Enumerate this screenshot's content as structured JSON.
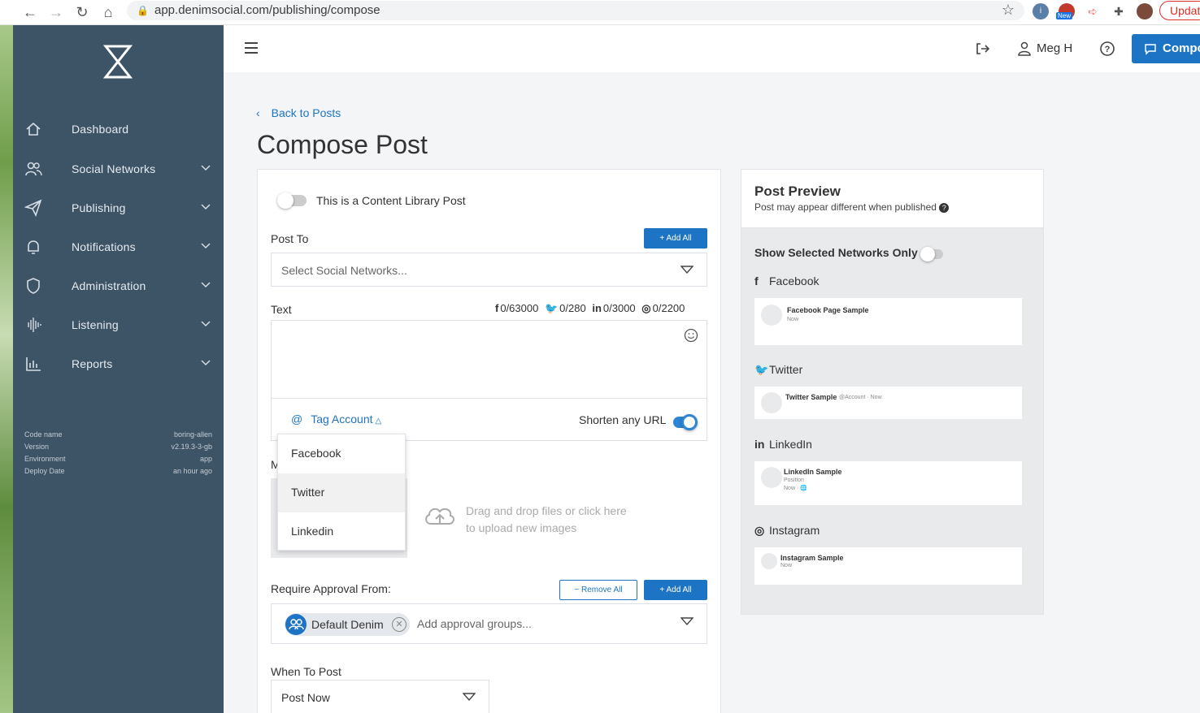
{
  "browser": {
    "url": "app.denimsocial.com/publishing/compose",
    "update_label": "Updat",
    "ext_badge": "New"
  },
  "sidebar": {
    "items": [
      {
        "label": "Dashboard",
        "icon": "home-icon"
      },
      {
        "label": "Social Networks",
        "icon": "users-icon"
      },
      {
        "label": "Publishing",
        "icon": "paper-plane-icon"
      },
      {
        "label": "Notifications",
        "icon": "bell-icon"
      },
      {
        "label": "Administration",
        "icon": "shield-icon"
      },
      {
        "label": "Listening",
        "icon": "waveform-icon"
      },
      {
        "label": "Reports",
        "icon": "bar-chart-icon"
      }
    ],
    "meta": [
      {
        "key": "Code name",
        "value": "boring-allen"
      },
      {
        "key": "Version",
        "value": "v2.19.3-3-gb"
      },
      {
        "key": "Environment",
        "value": "app"
      },
      {
        "key": "Deploy Date",
        "value": "an hour ago"
      }
    ]
  },
  "header": {
    "user_name": "Meg H",
    "compose_label": "Compo"
  },
  "page": {
    "back_label": "Back to Posts",
    "title": "Compose Post"
  },
  "compose": {
    "content_library_label": "This is a Content Library Post",
    "post_to_label": "Post To",
    "add_all_label": "+ Add All",
    "networks_placeholder": "Select Social Networks...",
    "text_label": "Text",
    "counts": {
      "facebook": "0/63000",
      "twitter": "0/280",
      "linkedin": "0/3000",
      "instagram": "0/2200"
    },
    "tag_account_label": "Tag Account",
    "shorten_label": "Shorten any URL",
    "tag_dropdown": [
      "Facebook",
      "Twitter",
      "Linkedin"
    ],
    "media_label_partial": "M",
    "upload_line1": "Drag and drop files or click here",
    "upload_line2": "to upload new images",
    "approval_label": "Require Approval From:",
    "remove_all_label": "− Remove All",
    "approval_add_all_label": "+ Add All",
    "approval_chip": "Default Denim",
    "approval_placeholder": "Add approval groups...",
    "when_label": "When To Post",
    "when_value": "Post Now"
  },
  "preview": {
    "title": "Post Preview",
    "subtitle": "Post may appear different when published",
    "show_selected_label": "Show Selected Networks Only",
    "networks": [
      {
        "name": "Facebook",
        "icon": "facebook-icon",
        "sample": "Facebook Page Sample",
        "meta": "Now"
      },
      {
        "name": "Twitter",
        "icon": "twitter-icon",
        "sample": "Twitter Sample",
        "meta": "@Account · Now"
      },
      {
        "name": "LinkedIn",
        "icon": "linkedin-icon",
        "sample": "LinkedIn Sample",
        "meta": "Position",
        "meta2": "Now · 🌐"
      },
      {
        "name": "Instagram",
        "icon": "instagram-icon",
        "sample": "Instagram Sample",
        "meta": "Now"
      }
    ]
  },
  "colors": {
    "sidebar": "#3d5366",
    "accent": "#1d74c4"
  }
}
